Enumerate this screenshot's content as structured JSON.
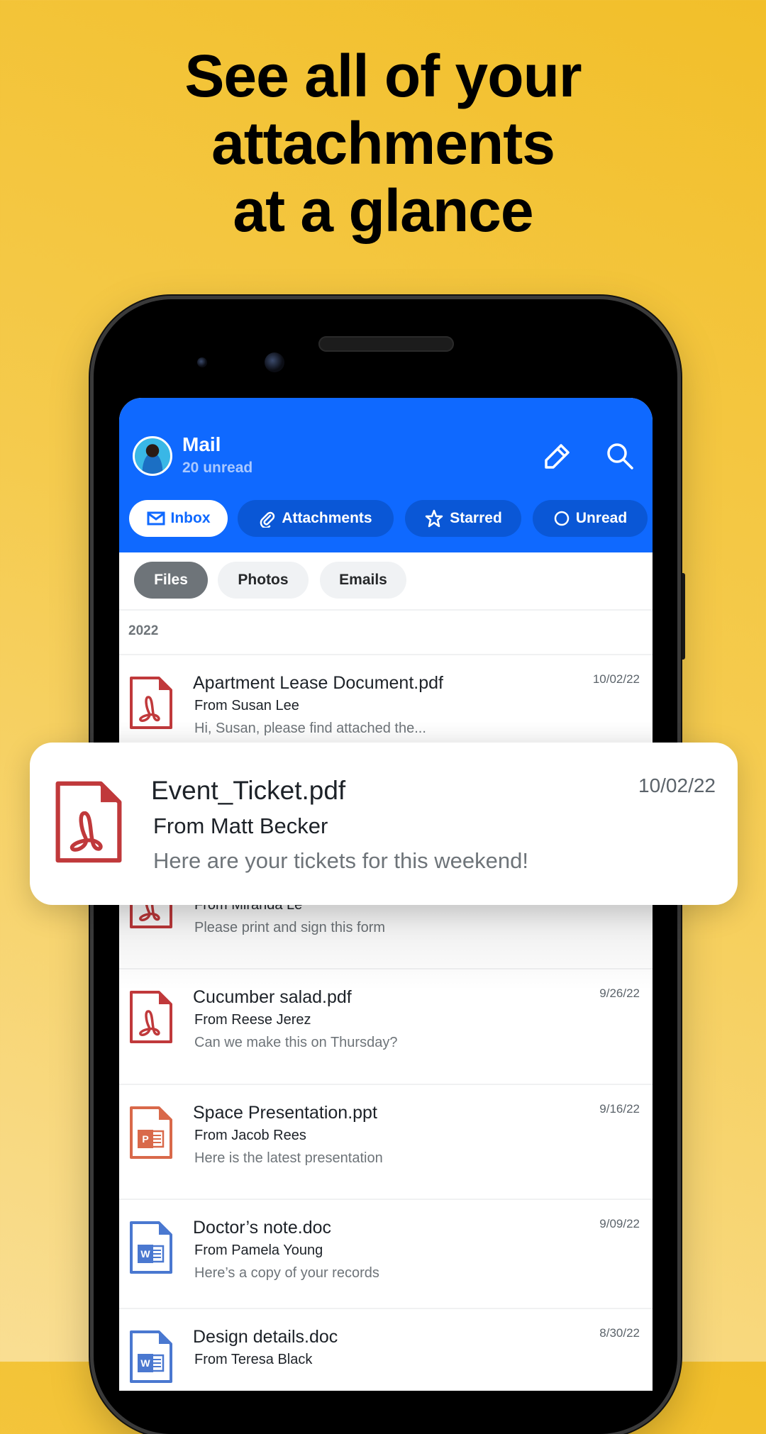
{
  "headline": [
    "See all of your",
    "attachments",
    "at a glance"
  ],
  "colors": {
    "header": "#0F69FF",
    "pdf": "#C0393B",
    "ppt": "#D9694A",
    "doc": "#4A78D0"
  },
  "header": {
    "title": "Mail",
    "subtitle": "20 unread",
    "icons": [
      "edit-pencil-icon",
      "search-icon"
    ]
  },
  "tabs": [
    {
      "label": "Inbox",
      "icon": "mail-icon",
      "active": true
    },
    {
      "label": "Attachments",
      "icon": "paperclip-icon",
      "active": false
    },
    {
      "label": "Starred",
      "icon": "star-icon",
      "active": false
    },
    {
      "label": "Unread",
      "icon": "circle-icon",
      "active": false
    }
  ],
  "filters": [
    {
      "label": "Files",
      "active": true
    },
    {
      "label": "Photos",
      "active": false
    },
    {
      "label": "Emails",
      "active": false
    }
  ],
  "section": "2022",
  "items": [
    {
      "name": "Apartment Lease Document.pdf",
      "from": "From Susan Lee",
      "preview": "Hi, Susan, please find attached the...",
      "date": "10/02/22",
      "type": "pdf"
    },
    {
      "name": "",
      "from": "From Miranda Le",
      "preview": "Please print and sign this form",
      "date": "",
      "type": "pdf"
    },
    {
      "name": "Cucumber salad.pdf",
      "from": "From Reese Jerez",
      "preview": "Can we make this on Thursday?",
      "date": "9/26/22",
      "type": "pdf"
    },
    {
      "name": "Space Presentation.ppt",
      "from": "From Jacob Rees",
      "preview": "Here is the latest presentation",
      "date": "9/16/22",
      "type": "ppt"
    },
    {
      "name": "Doctor’s note.doc",
      "from": "From Pamela Young",
      "preview": "Here’s a copy of your records",
      "date": "9/09/22",
      "type": "doc"
    },
    {
      "name": "Design details.doc",
      "from": "From Teresa Black",
      "preview": "",
      "date": "8/30/22",
      "type": "doc"
    }
  ],
  "highlight": {
    "name": "Event_Ticket.pdf",
    "from": "From Matt Becker",
    "preview": "Here are your tickets for this weekend!",
    "date": "10/02/22",
    "type": "pdf"
  }
}
